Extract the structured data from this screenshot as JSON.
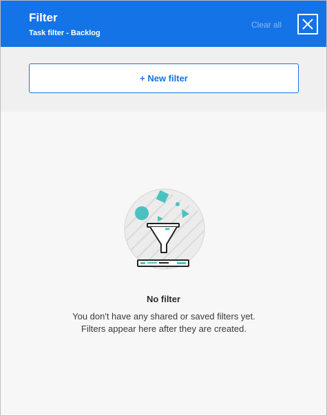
{
  "header": {
    "title": "Filter",
    "subtitle": "Task filter - Backlog",
    "clear_all_label": "Clear all",
    "close_icon": "close-icon"
  },
  "toolbar": {
    "new_filter_label": "+ New filter"
  },
  "empty_state": {
    "illustration_icon": "funnel-icon",
    "title": "No filter",
    "description": "You don't have any shared or saved filters yet. Filters appear here after they are created."
  },
  "colors": {
    "brand_blue": "#1473e6",
    "accent_teal": "#4cc1c1"
  }
}
